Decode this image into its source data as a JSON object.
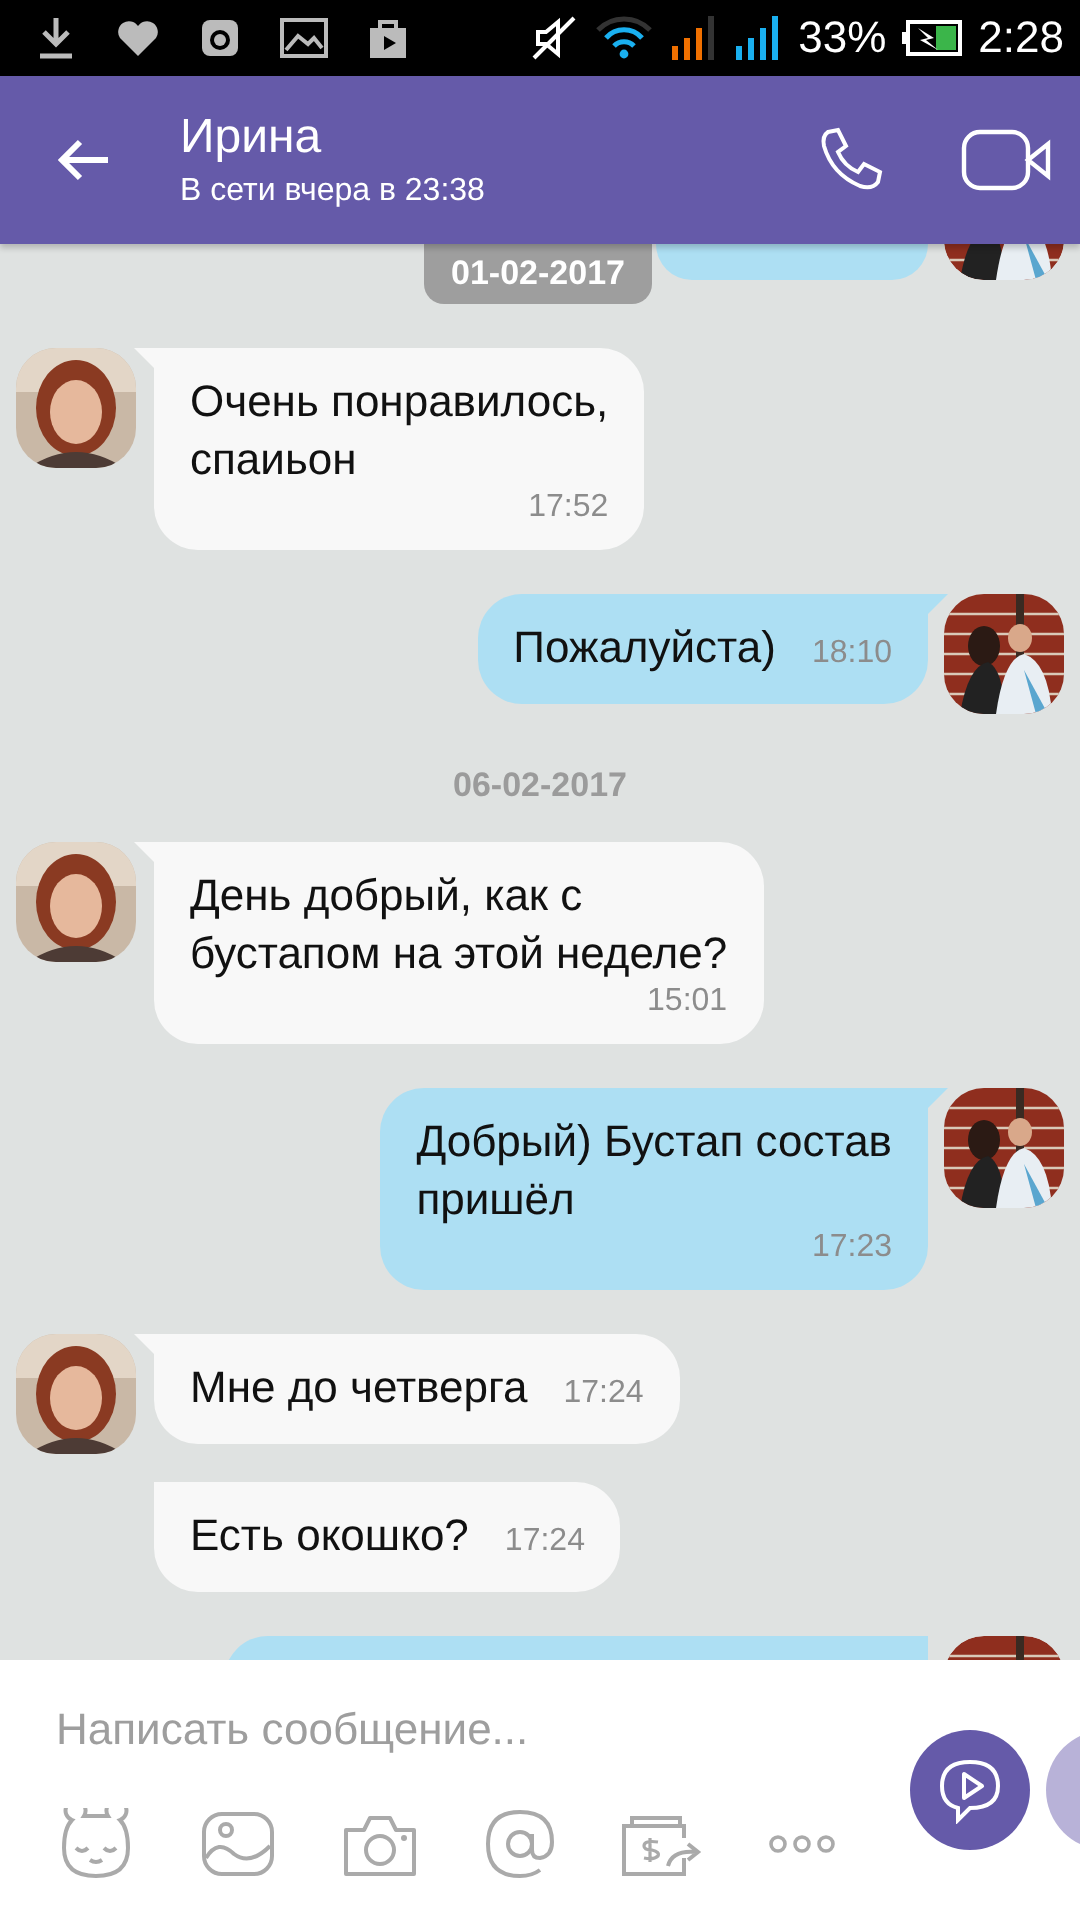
{
  "status_bar": {
    "battery": "33%",
    "time": "2:28"
  },
  "header": {
    "title": "Ирина",
    "subtitle": "В сети вчера в 23:38"
  },
  "messages": [
    {
      "kind": "sent_cut"
    },
    {
      "kind": "date_pill",
      "text": "01-02-2017"
    },
    {
      "kind": "received",
      "avatar": true,
      "text": "Очень понравилось,\nспаиьон",
      "time": "17:52",
      "time_below": true
    },
    {
      "kind": "sent",
      "avatar": true,
      "text": "Пожалуйста)",
      "time": "18:10",
      "time_below": false
    },
    {
      "kind": "date",
      "text": "06-02-2017"
    },
    {
      "kind": "received",
      "avatar": true,
      "text": "День добрый, как с\nбустапом на этой неделе?",
      "time": "15:01",
      "time_below": true
    },
    {
      "kind": "sent",
      "avatar": true,
      "text": "Добрый) Бустап состав\nпришёл",
      "time": "17:23",
      "time_below": true
    },
    {
      "kind": "received",
      "avatar": true,
      "text": "Мне до четверга",
      "time": "17:24",
      "time_below": false
    },
    {
      "kind": "received",
      "avatar": false,
      "text": "Есть окошко?",
      "time": "17:24",
      "time_below": false
    },
    {
      "kind": "sent_cut"
    }
  ],
  "composer": {
    "placeholder": "Написать сообщение..."
  }
}
